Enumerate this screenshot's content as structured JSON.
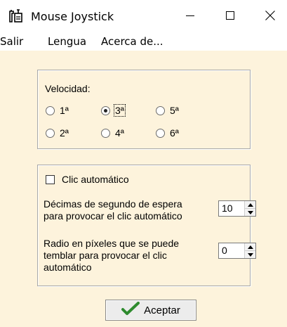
{
  "window": {
    "title": "Mouse Joystick",
    "app_icon": "joystick-icon",
    "controls": {
      "minimize": "minimize-icon",
      "maximize": "maximize-icon",
      "close": "close-icon"
    }
  },
  "menu": {
    "items": [
      {
        "label": "Salir"
      },
      {
        "label": "Lengua"
      },
      {
        "label": "Acerca de..."
      }
    ]
  },
  "speed": {
    "label": "Velocidad:",
    "options": [
      {
        "label": "1ª",
        "checked": false
      },
      {
        "label": "3ª",
        "checked": true
      },
      {
        "label": "5ª",
        "checked": false
      },
      {
        "label": "2ª",
        "checked": false
      },
      {
        "label": "4ª",
        "checked": false
      },
      {
        "label": "6ª",
        "checked": false
      }
    ]
  },
  "autoclick": {
    "checkbox_label": "Clic automático",
    "checked": false,
    "delay_label_line1": "Décimas de segundo de espera",
    "delay_label_line2": "para provocar el clic automático",
    "delay_value": "10",
    "radius_label_line1": "Radio en píxeles que se puede",
    "radius_label_line2": "temblar para provocar el clic",
    "radius_label_line3": "automático",
    "radius_value": "0"
  },
  "actions": {
    "accept_label": "Aceptar",
    "accept_icon": "checkmark-icon"
  },
  "colors": {
    "background": "#fdf3dc",
    "titlebar": "#ffffff",
    "check_green": "#2e8b2e"
  }
}
